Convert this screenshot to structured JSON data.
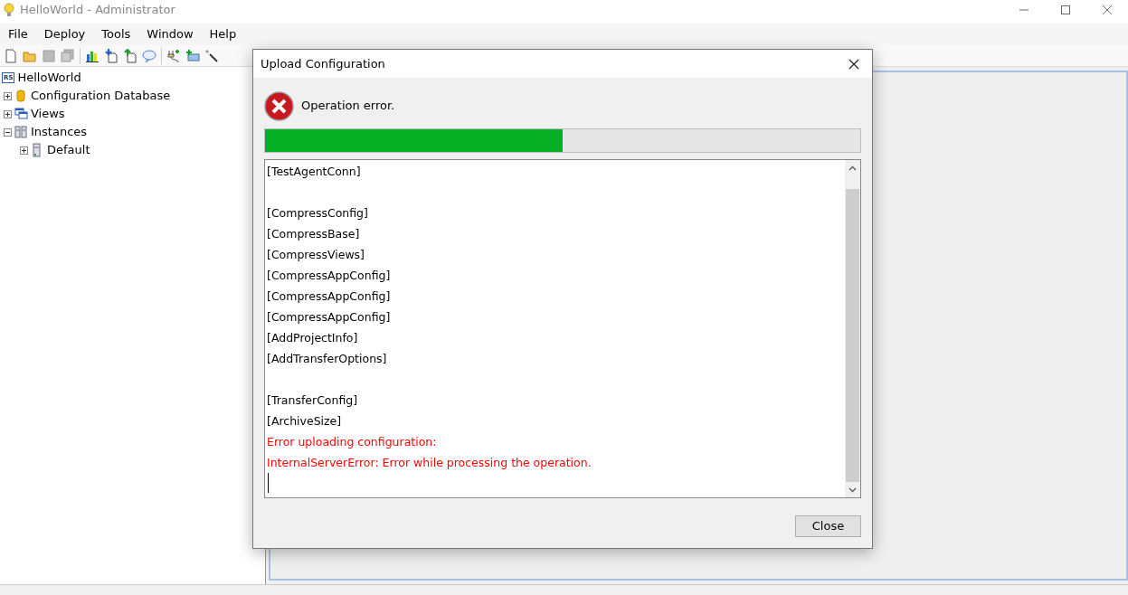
{
  "window": {
    "title": "HelloWorld - Administrator"
  },
  "menu": [
    "File",
    "Deploy",
    "Tools",
    "Window",
    "Help"
  ],
  "tree": {
    "logo": "RS",
    "label": "HelloWorld",
    "children": [
      {
        "label": "Configuration Database",
        "kind": "database",
        "expanded": false
      },
      {
        "label": "Views",
        "kind": "views",
        "expanded": false
      },
      {
        "label": "Instances",
        "kind": "instances",
        "expanded": true,
        "children": [
          {
            "label": "Default",
            "kind": "server",
            "expanded": false
          }
        ]
      }
    ]
  },
  "dialog": {
    "title": "Upload Configuration",
    "message": "Operation error.",
    "progress": {
      "level": 0.5
    },
    "log": [
      {
        "text": "[TestAgentConn]",
        "error": false,
        "space_before": false
      },
      {
        "text": "[CompressConfig]",
        "error": false,
        "space_before": true
      },
      {
        "text": "[CompressBase]",
        "error": false,
        "space_before": false
      },
      {
        "text": "[CompressViews]",
        "error": false,
        "space_before": false
      },
      {
        "text": "[CompressAppConfig]",
        "error": false,
        "space_before": false
      },
      {
        "text": "[CompressAppConfig]",
        "error": false,
        "space_before": false
      },
      {
        "text": "[CompressAppConfig]",
        "error": false,
        "space_before": false
      },
      {
        "text": "[AddProjectInfo]",
        "error": false,
        "space_before": false
      },
      {
        "text": "[AddTransferOptions]",
        "error": false,
        "space_before": false
      },
      {
        "text": "[TransferConfig]",
        "error": false,
        "space_before": true
      },
      {
        "text": "[ArchiveSize]",
        "error": false,
        "space_before": false
      },
      {
        "text": "Error uploading configuration:",
        "error": true,
        "space_before": false
      },
      {
        "text": "InternalServerError: Error while processing the operation.",
        "error": true,
        "space_before": false
      }
    ],
    "buttons": [
      "Close"
    ]
  }
}
